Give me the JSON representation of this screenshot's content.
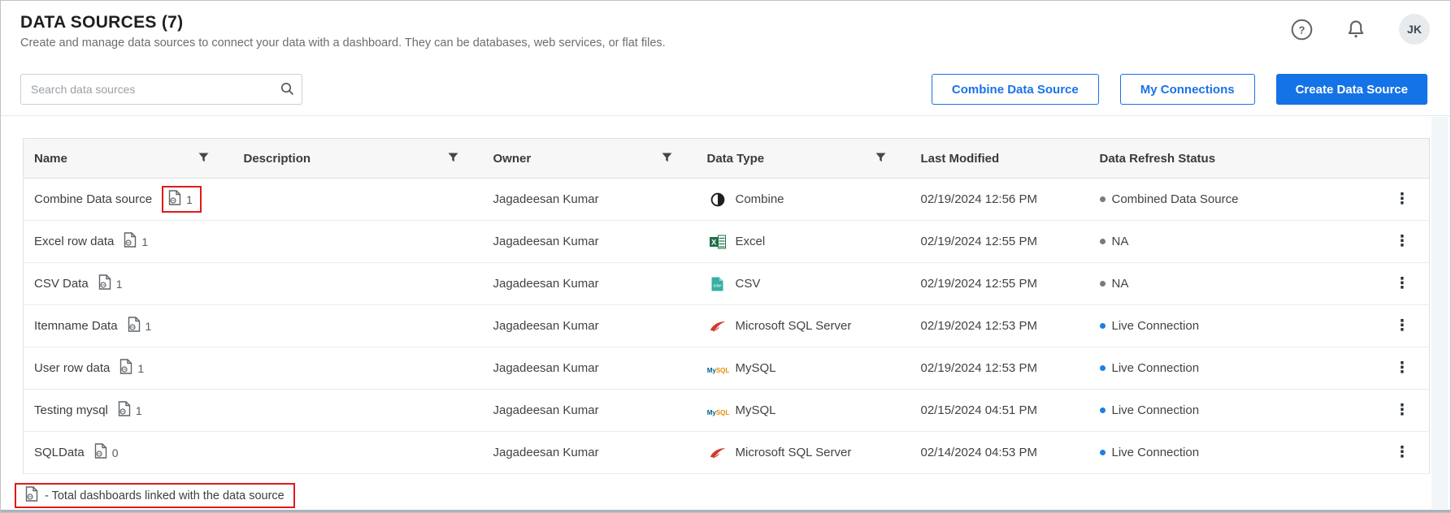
{
  "colors": {
    "accent_blue": "#1a73e8",
    "create_button_bg": "#1473e6",
    "status_live": "#1d7fe3",
    "status_neutral": "#7a7a7a",
    "annotation_red": "#e11a1a"
  },
  "header": {
    "title": "DATA SOURCES (7)",
    "subtitle": "Create and manage data sources to connect your data with a dashboard. They can be databases, web services, or flat files.",
    "avatar_initials": "JK"
  },
  "toolbar": {
    "search": {
      "placeholder": "Search data sources",
      "value": ""
    },
    "buttons": {
      "combine": "Combine Data Source",
      "my_connections": "My Connections",
      "create": "Create Data Source"
    }
  },
  "table": {
    "headers": [
      {
        "label": "Name"
      },
      {
        "label": "Description"
      },
      {
        "label": "Owner"
      },
      {
        "label": "Data Type"
      },
      {
        "label": "Last Modified"
      },
      {
        "label": "Data Refresh Status"
      }
    ],
    "rows": [
      {
        "name": "Combine Data source",
        "linked_dashboards": "1",
        "description": "",
        "owner": "Jagadeesan Kumar",
        "type": {
          "label": "Combine",
          "icon": "combine-icon"
        },
        "last_modified": "02/19/2024 12:56 PM",
        "status": {
          "label": "Combined Data Source",
          "dot_color": "#7a7a7a"
        }
      },
      {
        "name": "Excel row data",
        "linked_dashboards": "1",
        "description": "",
        "owner": "Jagadeesan Kumar",
        "type": {
          "label": "Excel",
          "icon": "excel-icon"
        },
        "last_modified": "02/19/2024 12:55 PM",
        "status": {
          "label": "NA",
          "dot_color": "#7a7a7a"
        }
      },
      {
        "name": "CSV Data",
        "linked_dashboards": "1",
        "description": "",
        "owner": "Jagadeesan Kumar",
        "type": {
          "label": "CSV",
          "icon": "csv-icon"
        },
        "last_modified": "02/19/2024 12:55 PM",
        "status": {
          "label": "NA",
          "dot_color": "#7a7a7a"
        }
      },
      {
        "name": "Itemname Data",
        "linked_dashboards": "1",
        "description": "",
        "owner": "Jagadeesan Kumar",
        "type": {
          "label": "Microsoft SQL Server",
          "icon": "sql-server-icon"
        },
        "last_modified": "02/19/2024 12:53 PM",
        "status": {
          "label": "Live Connection",
          "dot_color": "#1d7fe3"
        }
      },
      {
        "name": "User row data",
        "linked_dashboards": "1",
        "description": "",
        "owner": "Jagadeesan Kumar",
        "type": {
          "label": "MySQL",
          "icon": "mysql-icon"
        },
        "last_modified": "02/19/2024 12:53 PM",
        "status": {
          "label": "Live Connection",
          "dot_color": "#1d7fe3"
        }
      },
      {
        "name": "Testing mysql",
        "linked_dashboards": "1",
        "description": "",
        "owner": "Jagadeesan Kumar",
        "type": {
          "label": "MySQL",
          "icon": "mysql-icon"
        },
        "last_modified": "02/15/2024 04:51 PM",
        "status": {
          "label": "Live Connection",
          "dot_color": "#1d7fe3"
        }
      },
      {
        "name": "SQLData",
        "linked_dashboards": "0",
        "description": "",
        "owner": "Jagadeesan Kumar",
        "type": {
          "label": "Microsoft SQL Server",
          "icon": "sql-server-icon"
        },
        "last_modified": "02/14/2024 04:53 PM",
        "status": {
          "label": "Live Connection",
          "dot_color": "#1d7fe3"
        }
      }
    ]
  },
  "footer": {
    "note": "- Total dashboards linked with the data source"
  },
  "mysql_logo": {
    "my": "My",
    "sql": "SQL"
  }
}
